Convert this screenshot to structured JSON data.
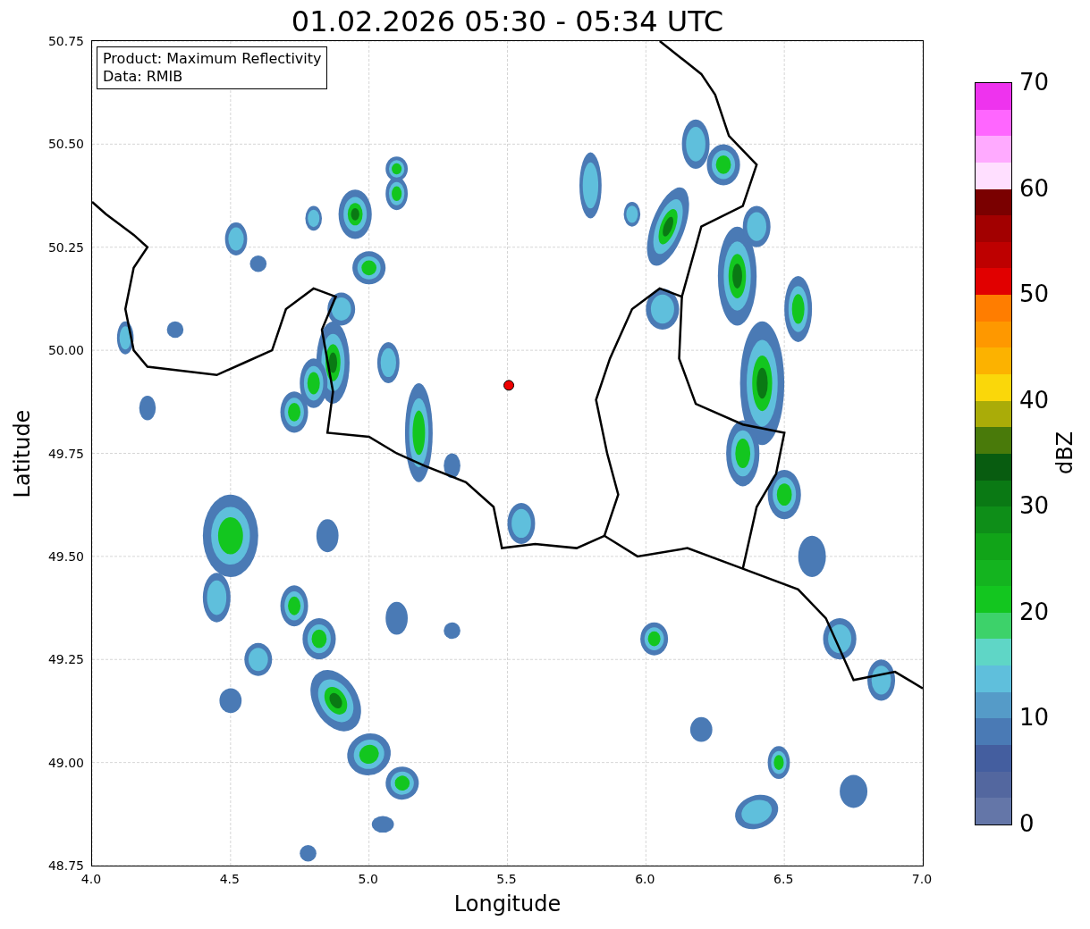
{
  "title": "01.02.2026 05:30 - 05:34 UTC",
  "legend": [
    "Product: Maximum Reflectivity",
    "Data: RMIB"
  ],
  "x_axis": {
    "label": "Longitude",
    "ticks": [
      "4.0",
      "4.5",
      "5.0",
      "5.5",
      "6.0",
      "6.5",
      "7.0"
    ]
  },
  "y_axis": {
    "label": "Latitude",
    "ticks": [
      "50.75",
      "50.50",
      "50.25",
      "50.00",
      "49.75",
      "49.50",
      "49.25",
      "49.00",
      "48.75"
    ]
  },
  "colorbar": {
    "label": "dBZ",
    "ticks": [
      "70",
      "60",
      "50",
      "40",
      "30",
      "20",
      "10",
      "0"
    ],
    "segments": [
      {
        "color": "#ee33ee"
      },
      {
        "color": "#ff66ff"
      },
      {
        "color": "#ffaaff"
      },
      {
        "color": "#ffdfff"
      },
      {
        "color": "#7a0000"
      },
      {
        "color": "#a20000"
      },
      {
        "color": "#be0000"
      },
      {
        "color": "#e10000"
      },
      {
        "color": "#ff7d00"
      },
      {
        "color": "#fe9800"
      },
      {
        "color": "#fcb200"
      },
      {
        "color": "#fad70a"
      },
      {
        "color": "#aaac08"
      },
      {
        "color": "#497a0a"
      },
      {
        "color": "#085c10"
      },
      {
        "color": "#0a7914"
      },
      {
        "color": "#0e8e18"
      },
      {
        "color": "#11a418"
      },
      {
        "color": "#14b41f"
      },
      {
        "color": "#13c61f"
      },
      {
        "color": "#3dd26a"
      },
      {
        "color": "#5fd6c6"
      },
      {
        "color": "#5fbfdc"
      },
      {
        "color": "#559bc8"
      },
      {
        "color": "#4a7ab5"
      },
      {
        "color": "#445e9f"
      },
      {
        "color": "#53679f"
      },
      {
        "color": "#6476a8"
      }
    ]
  }
}
